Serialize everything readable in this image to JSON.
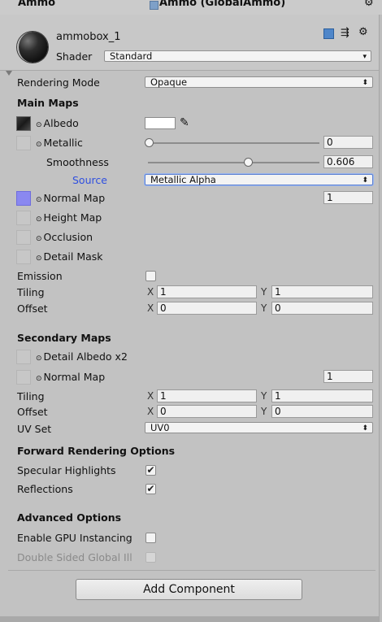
{
  "top": {
    "component": "Ammo",
    "script_ref": "Ammo (GlobalAmmo)",
    "gear": "⚙"
  },
  "header": {
    "material_name": "ammobox_1",
    "shader_label": "Shader",
    "shader_value": "Standard"
  },
  "rendering_mode": {
    "label": "Rendering Mode",
    "value": "Opaque"
  },
  "main_maps": {
    "title": "Main Maps",
    "albedo": "Albedo",
    "metallic": "Metallic",
    "metallic_value": "0",
    "smoothness": "Smoothness",
    "smoothness_value": "0.606",
    "source": "Source",
    "source_value": "Metallic Alpha",
    "normal_map": "Normal Map",
    "normal_value": "1",
    "height_map": "Height Map",
    "occlusion": "Occlusion",
    "detail_mask": "Detail Mask",
    "emission": "Emission",
    "tiling": "Tiling",
    "tiling_x": "1",
    "tiling_y": "1",
    "offset": "Offset",
    "offset_x": "0",
    "offset_y": "0"
  },
  "secondary_maps": {
    "title": "Secondary Maps",
    "detail_albedo": "Detail Albedo x2",
    "normal_map": "Normal Map",
    "normal_value": "1",
    "tiling": "Tiling",
    "tiling_x": "1",
    "tiling_y": "1",
    "offset": "Offset",
    "offset_x": "0",
    "offset_y": "0",
    "uv_set": "UV Set",
    "uv_value": "UV0"
  },
  "forward": {
    "title": "Forward Rendering Options",
    "specular": "Specular Highlights",
    "reflections": "Reflections"
  },
  "advanced": {
    "title": "Advanced Options",
    "gpu_instancing": "Enable GPU Instancing",
    "double_sided": "Double Sided Global Ill"
  },
  "labels": {
    "x": "X",
    "y": "Y",
    "checkmark": "✔",
    "dot": "⊙",
    "arrow": "♦"
  },
  "add_component": "Add Component",
  "colors": {
    "source": "#2f4fe0",
    "normal_tex": "#8a88f0"
  }
}
